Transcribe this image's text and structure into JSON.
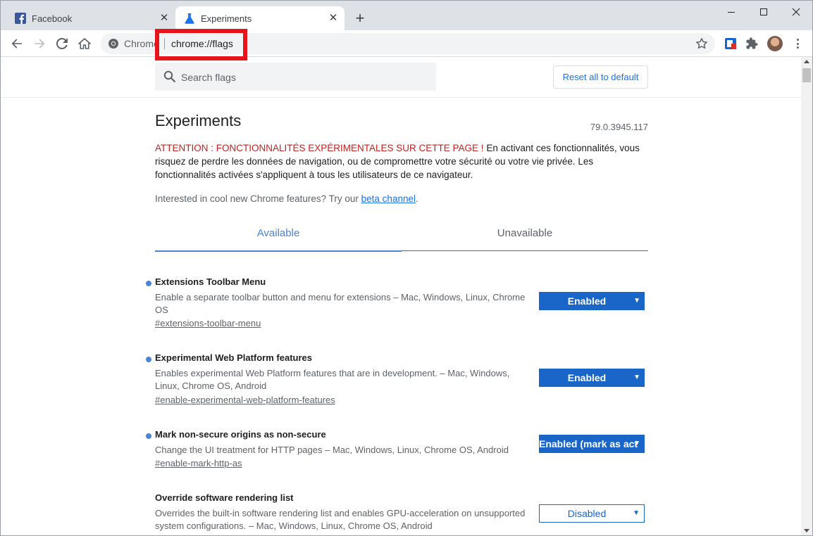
{
  "tabs": [
    {
      "title": "Facebook",
      "icon": "facebook-icon"
    },
    {
      "title": "Experiments",
      "icon": "flask-icon"
    }
  ],
  "toolbar": {
    "chip_label": "Chrome",
    "url": "chrome://flags"
  },
  "page": {
    "search_placeholder": "Search flags",
    "reset_label": "Reset all to default",
    "title": "Experiments",
    "version": "79.0.3945.117",
    "warning_red": "ATTENTION : FONCTIONNALITÉS EXPÉRIMENTALES SUR CETTE PAGE !",
    "warning_rest": " En activant ces fonctionnalités, vous risquez de perdre les données de navigation, ou de compromettre votre sécurité ou votre vie privée. Les fonctionnalités activées s'appliquent à tous les utilisateurs de ce navigateur.",
    "interested_prefix": "Interested in cool new Chrome features? Try our ",
    "interested_link": "beta channel",
    "interested_suffix": ".",
    "tab_available": "Available",
    "tab_unavailable": "Unavailable"
  },
  "flags": [
    {
      "name": "Extensions Toolbar Menu",
      "desc": "Enable a separate toolbar button and menu for extensions – Mac, Windows, Linux, Chrome OS",
      "hash": "#extensions-toolbar-menu",
      "value": "Enabled",
      "modified": true
    },
    {
      "name": "Experimental Web Platform features",
      "desc": "Enables experimental Web Platform features that are in development. – Mac, Windows, Linux, Chrome OS, Android",
      "hash": "#enable-experimental-web-platform-features",
      "value": "Enabled",
      "modified": true
    },
    {
      "name": "Mark non-secure origins as non-secure",
      "desc": "Change the UI treatment for HTTP pages – Mac, Windows, Linux, Chrome OS, Android",
      "hash": "#enable-mark-http-as",
      "value": "Enabled (mark as act",
      "modified": true
    },
    {
      "name": "Override software rendering list",
      "desc": "Overrides the built-in software rendering list and enables GPU-acceleration on unsupported system configurations. – Mac, Windows, Linux, Chrome OS, Android",
      "hash": "",
      "value": "Disabled",
      "modified": false
    }
  ],
  "colors": {
    "accent": "#1a73e8",
    "warning_red": "#c5221f",
    "highlight": "#e8141c"
  }
}
